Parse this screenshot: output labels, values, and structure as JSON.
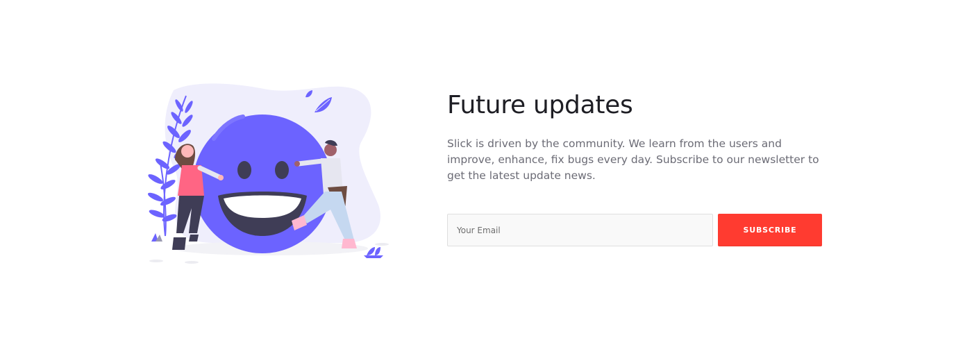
{
  "newsletter": {
    "title": "Future updates",
    "description": "Slick is driven by the community. We learn from the users and improve, enhance, fix bugs every day. Subscribe to our newsletter to get the latest update news.",
    "email_placeholder": "Your Email",
    "subscribe_label": "SUBSCRIBE"
  },
  "illustration": {
    "icon": "smiley-hug-illustration",
    "colors": {
      "primary": "#6c63ff",
      "blob": "#efeefc",
      "face": "#3f3d56"
    }
  },
  "colors": {
    "accent": "#ff3b30",
    "title": "#1e1e24",
    "text": "#6b6b75"
  }
}
